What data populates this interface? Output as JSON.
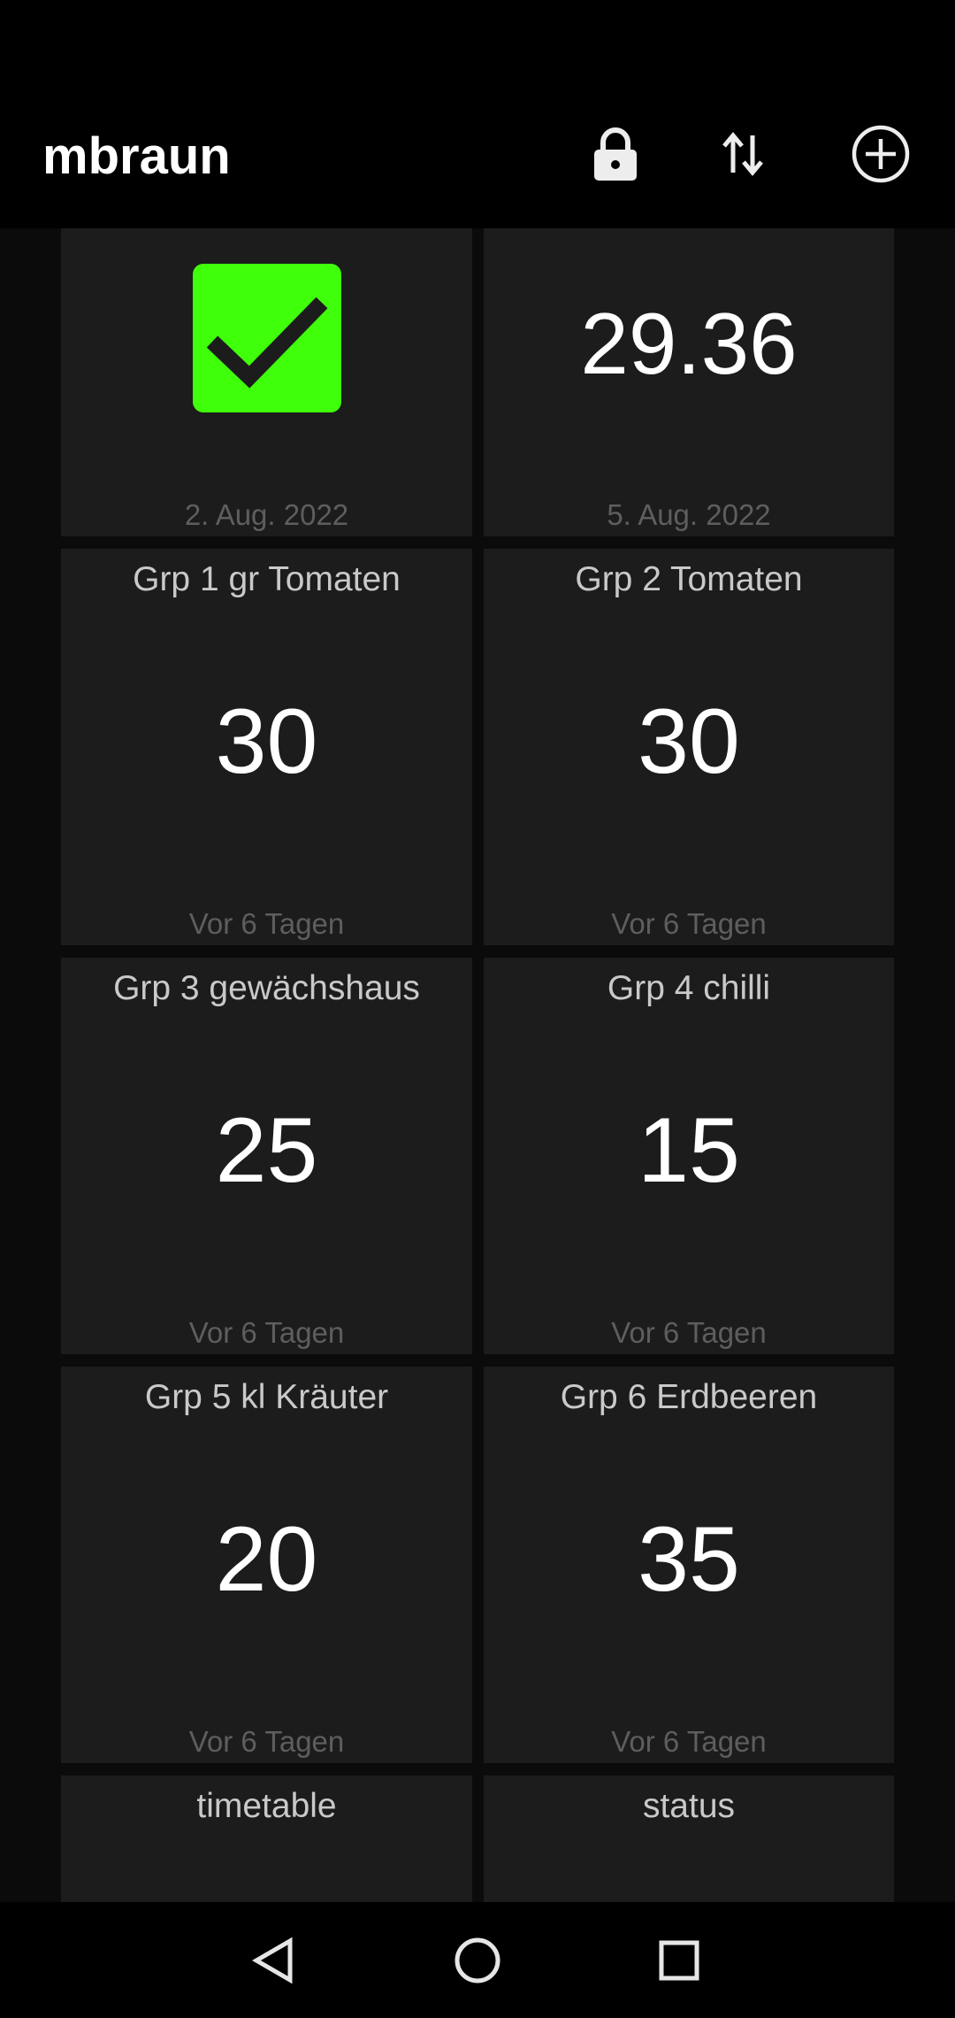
{
  "app_bar": {
    "title": "mbraun",
    "actions": [
      {
        "icon": "lock-icon"
      },
      {
        "icon": "swap-vertical-icon"
      },
      {
        "icon": "add-circle-icon"
      }
    ]
  },
  "tiles": {
    "status_check": {
      "footer": "2. Aug. 2022",
      "checked": true,
      "icon": "checkmark-icon",
      "color": "#3fff0a"
    },
    "reading": {
      "value": "29.36",
      "footer": "5. Aug. 2022"
    },
    "grp1": {
      "title": "Grp 1 gr Tomaten",
      "value": "30",
      "footer": "Vor 6 Tagen"
    },
    "grp2": {
      "title": "Grp 2 Tomaten",
      "value": "30",
      "footer": "Vor 6 Tagen"
    },
    "grp3": {
      "title": "Grp 3 gewächshaus",
      "value": "25",
      "footer": "Vor 6 Tagen"
    },
    "grp4": {
      "title": "Grp 4 chilli",
      "value": "15",
      "footer": "Vor 6 Tagen"
    },
    "grp5": {
      "title": "Grp 5 kl Kräuter",
      "value": "20",
      "footer": "Vor 6 Tagen"
    },
    "grp6": {
      "title": "Grp 6 Erdbeeren",
      "value": "35",
      "footer": "Vor 6 Tagen"
    },
    "timetable": {
      "title": "timetable"
    },
    "status": {
      "title": "status"
    }
  },
  "nav_bar": {
    "buttons": [
      {
        "icon": "back-triangle-icon"
      },
      {
        "icon": "home-circle-icon"
      },
      {
        "icon": "recents-square-icon"
      }
    ]
  },
  "colors": {
    "background": "#000000",
    "tile": "#1c1c1d",
    "accent_green": "#3fff0a"
  }
}
